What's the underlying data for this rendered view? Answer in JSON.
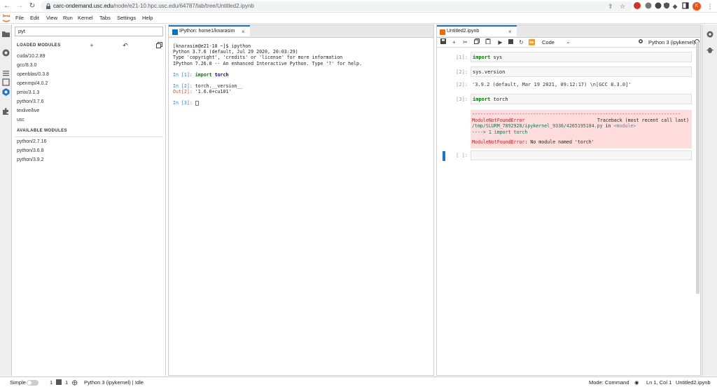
{
  "browser": {
    "url_host": "carc-ondemand.usc.edu",
    "url_path": "/node/e21-10.hpc.usc.edu/64787/lab/tree/Untitled2.ipynb",
    "profile_initial": "K"
  },
  "menu": [
    "File",
    "Edit",
    "View",
    "Run",
    "Kernel",
    "Tabs",
    "Settings",
    "Help"
  ],
  "extensions": {
    "filter_value": "pyt",
    "loaded_header": "LOADED MODULES",
    "loaded": [
      "cuda/10.2.89",
      "gcc/8.3.0",
      "openblas/0.3.8",
      "openmpi/4.0.2",
      "pmix/3.1.3",
      "python/3.7.6",
      "texlive/live",
      "usc"
    ],
    "available_header": "AVAILABLE MODULES",
    "available": [
      "python/2.7.16",
      "python/3.6.8",
      "python/3.9.2"
    ]
  },
  "console": {
    "tab_title": "IPython: home1/knarasim",
    "lines": [
      "[knarasim@e21-10 ~]$ ipython",
      "Python 3.7.6 (default, Jul 29 2020, 20:03:29)",
      "Type 'copyright', 'credits' or 'license' for more information",
      "IPython 7.26.0 -- An enhanced Interactive Python. Type '?' for help."
    ],
    "in1_prompt": "In [1]:",
    "in1_kw": "import",
    "in1_mod": "torch",
    "in2_prompt": "In [2]:",
    "in2_code": "torch.__version__",
    "out2_prompt": "Out[2]:",
    "out2_value": "'1.6.0+cu101'",
    "in3_prompt": "In [3]:"
  },
  "notebook": {
    "tab_title": "Untitled2.ipynb",
    "cell_type": "Code",
    "kernel": "Python 3 (ipykernel)",
    "cells": {
      "c1_prompt": "[1]:",
      "c1_kw": "import",
      "c1_mod": "sys",
      "c2_prompt": "[2]:",
      "c2_code": "sys.version",
      "c2_out_prompt": "[2]:",
      "c2_out": "'3.9.2 (default, Mar 19 2021, 09:12:17) \\n[GCC 8.3.0]'",
      "c3_prompt": "[3]:",
      "c3_kw": "import",
      "c3_mod": "torch",
      "c4_prompt": "[ ]:"
    },
    "error": {
      "dashes": "---------------------------------------------------------------------------",
      "name": "ModuleNotFoundError",
      "traceback_label": "Traceback (most recent call last)",
      "file": "/tmp/SLURM_7892928/ipykernel_9336/4265195184.py",
      "in_word": " in ",
      "module": "<module>",
      "arrow": "----> 1 import torch",
      "final_name": "ModuleNotFoundError",
      "final_msg": ": No module named 'torch'"
    }
  },
  "status": {
    "mode_label": "Simple",
    "count1": "1",
    "count2": "1",
    "kernel_status": "Python 3 (ipykernel) | Idle",
    "mode": "Mode: Command",
    "position": "Ln 1, Col 1",
    "filename": "Untitled2.ipynb"
  }
}
